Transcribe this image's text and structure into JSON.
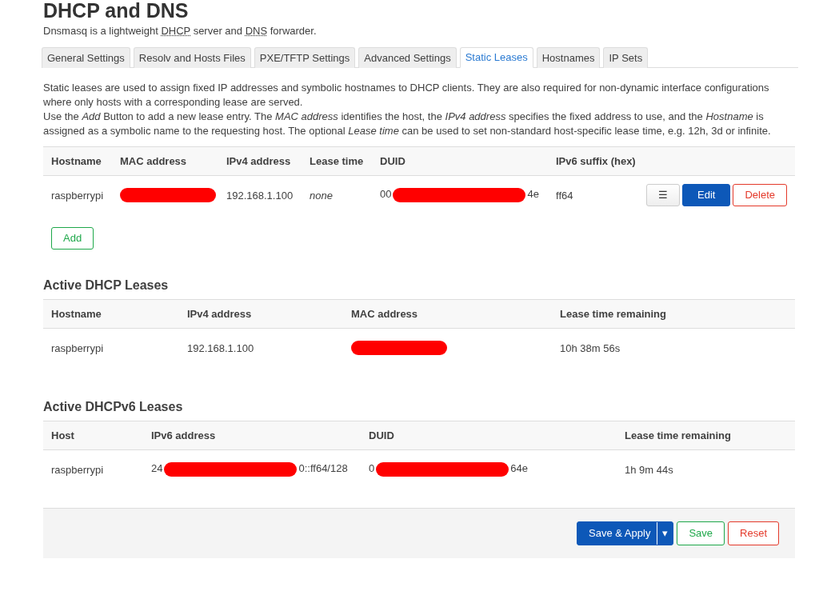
{
  "page": {
    "title": "DHCP and DNS",
    "subtitle_parts": [
      {
        "text": "Dnsmasq is a lightweight ",
        "abbr": false
      },
      {
        "text": "DHCP",
        "abbr": true
      },
      {
        "text": " server and ",
        "abbr": false
      },
      {
        "text": "DNS",
        "abbr": true
      },
      {
        "text": " forwarder.",
        "abbr": false
      }
    ]
  },
  "tabs": [
    {
      "label": "General Settings",
      "selected": false
    },
    {
      "label": "Resolv and Hosts Files",
      "selected": false
    },
    {
      "label": "PXE/TFTP Settings",
      "selected": false
    },
    {
      "label": "Advanced Settings",
      "selected": false
    },
    {
      "label": "Static Leases",
      "selected": true
    },
    {
      "label": "Hostnames",
      "selected": false
    },
    {
      "label": "IP Sets",
      "selected": false
    }
  ],
  "description": [
    "Static leases are used to assign fixed IP addresses and symbolic hostnames to DHCP clients. They are also required for non-dynamic interface configurations where only hosts with a corresponding lease are served.",
    "Use the *Add* Button to add a new lease entry. The *MAC address* identifies the host, the *IPv4 address* specifies the fixed address to use, and the *Hostname* is assigned as a symbolic name to the requesting host. The optional *Lease time* can be used to set non-standard host-specific lease time, e.g. 12h, 3d or infinite."
  ],
  "static_leases": {
    "columns": [
      "Hostname",
      "MAC address",
      "IPv4 address",
      "Lease time",
      "DUID",
      "IPv6 suffix (hex)"
    ],
    "rows": [
      {
        "cells": [
          {
            "text": "raspberrypi"
          },
          {
            "redacted": true
          },
          {
            "text": "192.168.1.100"
          },
          {
            "text": "none",
            "italic": true
          },
          {
            "start": "00",
            "end": "4e",
            "redacted": true
          },
          {
            "text": "ff64"
          }
        ],
        "actions": [
          {
            "kind": "menu",
            "label": "☰"
          },
          {
            "kind": "edit",
            "label": "Edit"
          },
          {
            "kind": "delete",
            "label": "Delete"
          }
        ]
      }
    ],
    "add_button": "Add"
  },
  "active_dhcp": {
    "title": "Active DHCP Leases",
    "columns": [
      "Hostname",
      "IPv4 address",
      "MAC address",
      "Lease time remaining"
    ],
    "rows": [
      {
        "cells": [
          {
            "text": "raspberrypi"
          },
          {
            "text": "192.168.1.100"
          },
          {
            "redacted": true
          },
          {
            "text": "10h 38m 56s"
          }
        ]
      }
    ]
  },
  "active_dhcpv6": {
    "title": "Active DHCPv6 Leases",
    "columns": [
      "Host",
      "IPv6 address",
      "DUID",
      "Lease time remaining"
    ],
    "rows": [
      {
        "cells": [
          {
            "text": "raspberrypi"
          },
          {
            "start": "24",
            "end": "0::ff64/128",
            "redacted": true
          },
          {
            "start": "0",
            "end": "64e",
            "redacted": true
          },
          {
            "text": "1h 9m 44s"
          }
        ]
      }
    ]
  },
  "footer": {
    "buttons": [
      {
        "kind": "apply",
        "label": "Save & Apply",
        "caret": "▾"
      },
      {
        "kind": "save",
        "label": "Save"
      },
      {
        "kind": "reset",
        "label": "Reset"
      }
    ]
  }
}
